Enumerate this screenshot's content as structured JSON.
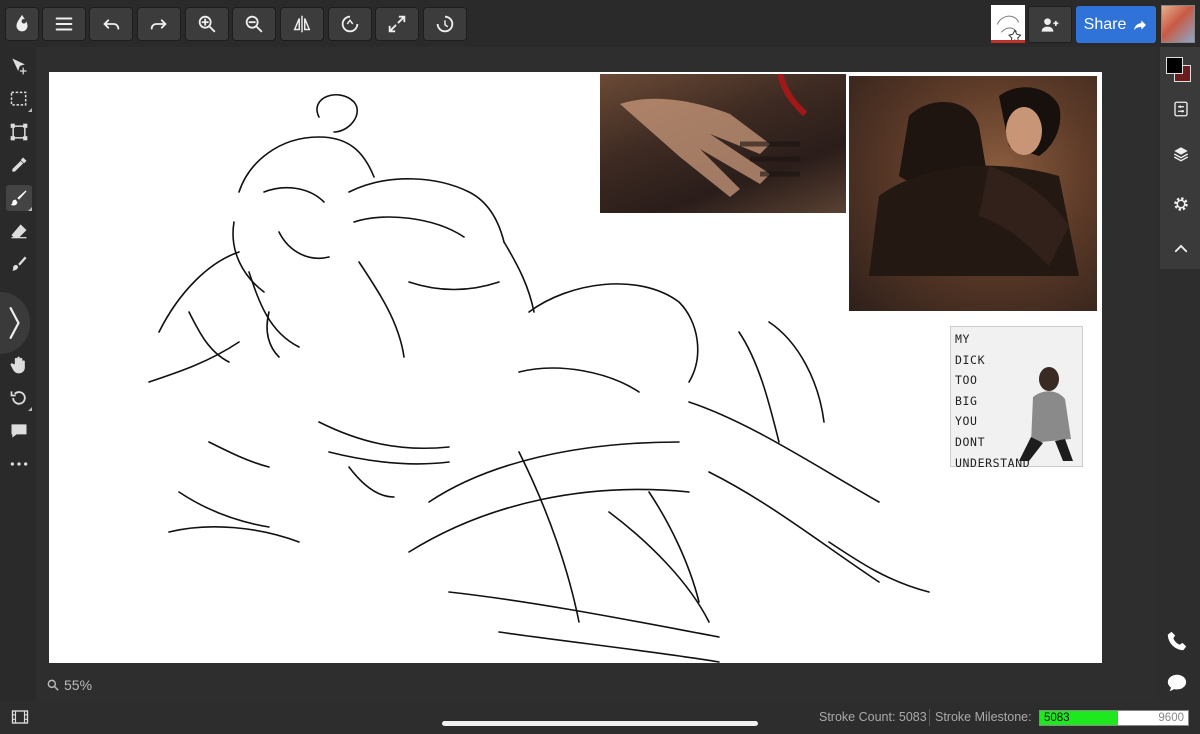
{
  "toolbar": {
    "buttons": [
      "logo",
      "menu",
      "undo",
      "redo",
      "zoom-in",
      "zoom-out",
      "flip",
      "rotate-reset",
      "fullscreen",
      "rotate"
    ],
    "share_label": "Share",
    "accent": "#2f73d8"
  },
  "tools": [
    "move",
    "select",
    "transform",
    "eyedropper",
    "brush",
    "eraser",
    "fill",
    "collapse",
    "hand",
    "history",
    "comment",
    "more"
  ],
  "right_panel": [
    "color",
    "adjustments",
    "layers",
    "settings",
    "collapse-up"
  ],
  "canvas": {
    "zoom": "55%",
    "meme_text": "MY\nDICK\nTOO\nBIG\nYOU\nDONT\nUNDERSTAND"
  },
  "status": {
    "stroke_count_label": "Stroke Count: 5083",
    "milestone_label": "Stroke Milestone:",
    "milestone_value": "5083",
    "milestone_target": "9600",
    "milestone_progress": 0.529,
    "milestone_color": "#1ee81e"
  }
}
